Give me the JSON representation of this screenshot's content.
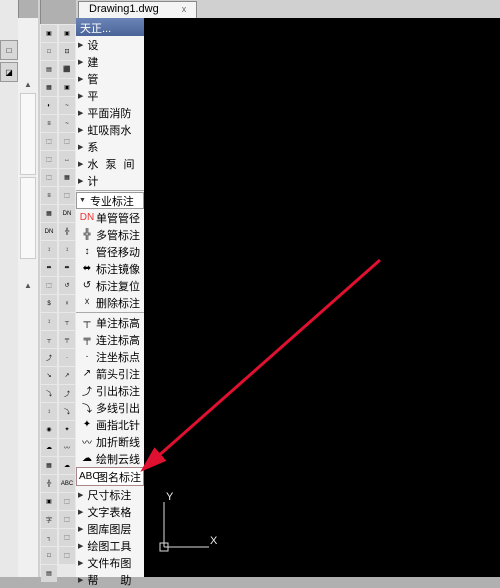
{
  "tab": {
    "title": "Drawing1.dwg",
    "close": "x"
  },
  "menu_header": "天正...",
  "menu_main": [
    {
      "label": "设　　置",
      "sp": "sp4"
    },
    {
      "label": "建　　筑",
      "sp": "sp4"
    },
    {
      "label": "管　　线",
      "sp": "sp4"
    },
    {
      "label": "平　　面",
      "sp": "sp4"
    },
    {
      "label": "平面消防",
      "sp": ""
    },
    {
      "label": "虹吸雨水",
      "sp": ""
    },
    {
      "label": "系　　统",
      "sp": "sp4"
    },
    {
      "label": "水 泵 间",
      "sp": "sp3"
    },
    {
      "label": "计　　算",
      "sp": "sp4"
    }
  ],
  "menu_label_special": "专业标注",
  "menu_icons": [
    {
      "icon": "DN",
      "label": "单管管径",
      "color": "ic-red"
    },
    {
      "icon": "╬",
      "label": "多管标注",
      "color": ""
    },
    {
      "icon": "↕",
      "label": "管径移动",
      "color": ""
    },
    {
      "icon": "⬌",
      "label": "标注镜像",
      "color": ""
    },
    {
      "icon": "↺",
      "label": "标注复位",
      "color": ""
    },
    {
      "icon": "☓",
      "label": "删除标注",
      "color": ""
    }
  ],
  "menu_icons2": [
    {
      "icon": "┬",
      "label": "单注标高",
      "color": ""
    },
    {
      "icon": "╤",
      "label": "连注标高",
      "color": ""
    },
    {
      "icon": "·",
      "label": "注坐标点",
      "color": ""
    },
    {
      "icon": "↗",
      "label": "箭头引注",
      "color": ""
    },
    {
      "icon": "⤴",
      "label": "引出标注",
      "color": ""
    },
    {
      "icon": "⤵",
      "label": "多线引出",
      "color": ""
    },
    {
      "icon": "✦",
      "label": "画指北针",
      "color": ""
    },
    {
      "icon": "〰",
      "label": "加折断线",
      "color": ""
    },
    {
      "icon": "☁",
      "label": "绘制云线",
      "color": ""
    },
    {
      "icon": "ABC",
      "label": "图名标注",
      "color": "",
      "highlight": true
    }
  ],
  "menu_sub": [
    {
      "label": "尺寸标注"
    },
    {
      "label": "文字表格"
    },
    {
      "label": "图库图层"
    },
    {
      "label": "绘图工具"
    },
    {
      "label": "文件布图"
    },
    {
      "label": "帮　　助"
    }
  ],
  "ucs": {
    "x_label": "X",
    "y_label": "Y"
  },
  "toolbar_col1_icons": [
    "▣",
    "□",
    "▤",
    "▦",
    "◐",
    "≡",
    "⬚",
    "⬚",
    "⬚",
    "≡",
    "▦",
    "DN",
    "↕",
    "⬌",
    "⬚",
    "$",
    "↕",
    "┬",
    "⤴",
    "↘",
    "⤵",
    "↕",
    "◉",
    "☁",
    "▦",
    "╬",
    "▣",
    "字",
    "┐",
    "□",
    "▤"
  ],
  "toolbar_col2_icons": [
    "▣",
    "⊡",
    "⬛",
    "▣",
    "~",
    "~",
    "⬚",
    "↔",
    "▦",
    "⬚",
    "DN",
    "╬",
    "↕",
    "⬌",
    "↺",
    "☓",
    "┬",
    "╤",
    "·",
    "↗",
    "⤴",
    "⤵",
    "✦",
    "〰",
    "☁",
    "ABC",
    "⬚",
    "⬚",
    "⬚",
    "⬚"
  ],
  "left_toolbar_icons": [
    "□",
    "■"
  ]
}
